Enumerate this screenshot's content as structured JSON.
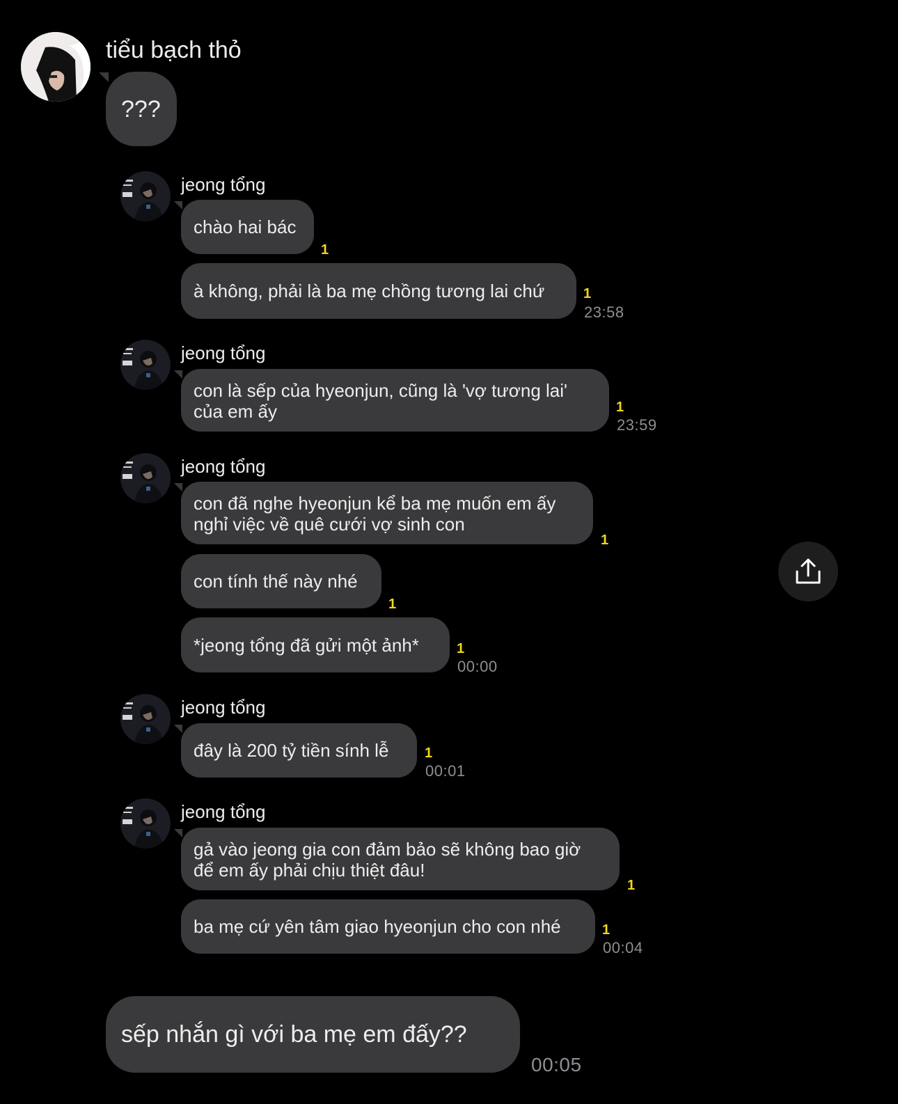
{
  "header_sender": "tiểu bạch thỏ",
  "messages": [
    {
      "sender": "jeong tổng",
      "text": "chào hai bác",
      "read": "1"
    },
    {
      "text": "à không, phải là ba mẹ chồng tương lai chứ",
      "read": "1",
      "time": "23:58"
    },
    {
      "sender": "jeong tổng",
      "line1": "con là sếp của hyeonjun, cũng là 'vợ tương lai'",
      "line2": "của em ấy",
      "read": "1",
      "time": "23:59"
    },
    {
      "sender": "jeong tổng",
      "line1": "con đã nghe hyeonjun kể ba mẹ muốn em ấy",
      "line2": "nghỉ việc về quê cưới vợ sinh con",
      "read": "1"
    },
    {
      "text": "con tính thế này nhé",
      "read": "1"
    },
    {
      "text": "*jeong tổng đã gửi một ảnh*",
      "read": "1",
      "time": "00:00"
    },
    {
      "sender": "jeong tổng",
      "text": "đây là 200 tỷ tiền sính lễ",
      "read": "1",
      "time": "00:01"
    },
    {
      "sender": "jeong tổng",
      "line1": "gả vào jeong gia con đảm bảo sẽ không bao giờ",
      "line2": "để em ấy phải chịu thiệt đâu!",
      "read": "1"
    },
    {
      "text": "ba mẹ cứ yên tâm giao hyeonjun cho con nhé",
      "read": "1",
      "time": "00:04"
    }
  ],
  "first_message": "???",
  "last_message": {
    "text": "sếp nhắn gì với ba mẹ em đấy??",
    "time": "00:05"
  },
  "icons": {
    "share": "share-upload-icon",
    "avatar_top": "avatar-hooded-person",
    "avatar_sender": "avatar-dark-portrait"
  },
  "colors": {
    "background": "#000000",
    "bubble": "#3a3a3c",
    "read_receipt": "#f4d51b",
    "timestamp": "#8e8e93"
  }
}
